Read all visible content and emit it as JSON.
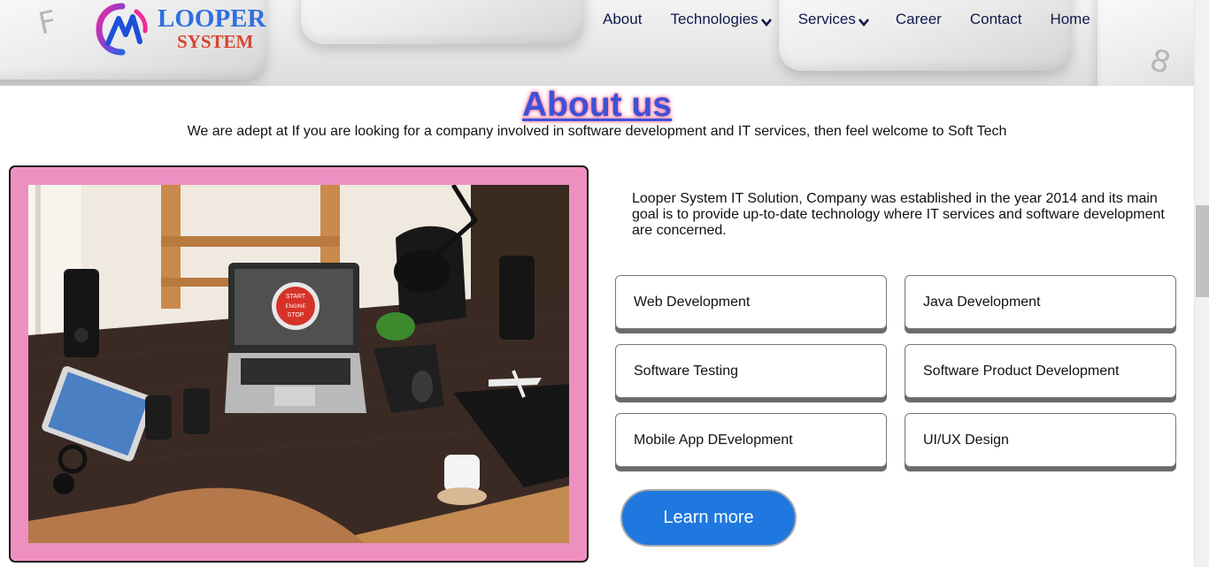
{
  "brand": {
    "name_line1": "LOOPER",
    "name_line2": "SYSTEM"
  },
  "nav": {
    "items": [
      {
        "label": "About",
        "has_dropdown": false
      },
      {
        "label": "Technologies",
        "has_dropdown": true
      },
      {
        "label": "Services",
        "has_dropdown": true
      },
      {
        "label": "Career",
        "has_dropdown": false
      },
      {
        "label": "Contact",
        "has_dropdown": false
      },
      {
        "label": "Home",
        "has_dropdown": false
      }
    ],
    "dropdown_icon": "chevron-down-icon"
  },
  "about": {
    "title": "About us",
    "subtitle": "We are adept at If you are looking for a company involved in software development and IT services, then feel welcome to Soft Tech",
    "intro": "Looper System IT Solution, Company was established in the year 2014 and its main goal is to provide up-to-date technology where IT services and software development are concerned.",
    "services": [
      "Web Development",
      "Java Development",
      "Software Testing",
      "Software Product Development",
      "Mobile App DEvelopment",
      "UI/UX Design"
    ],
    "cta_label": "Learn more",
    "photo_screen_text": [
      "START",
      "ENGINE",
      "STOP"
    ]
  },
  "colors": {
    "title": "#3c52d6",
    "title_glow": "#ff5a8a",
    "frame": "#ee8fc1",
    "cta": "#1f78e0",
    "nav_text": "#0f1a4d"
  }
}
